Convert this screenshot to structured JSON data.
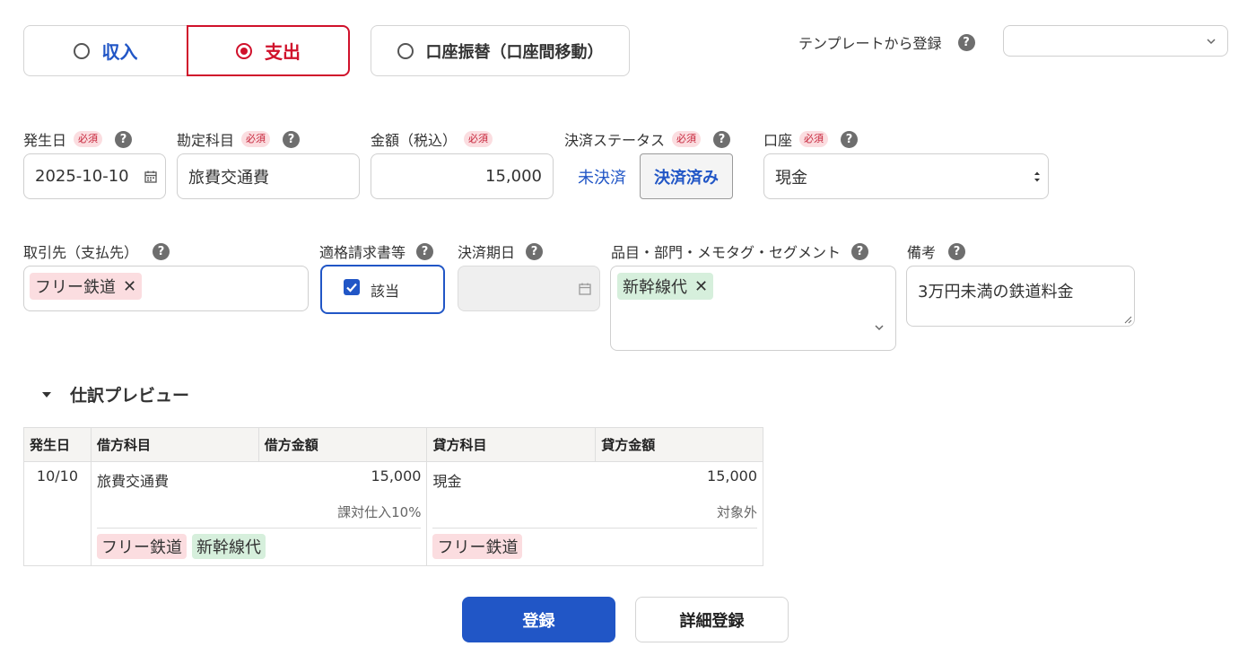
{
  "type_selector": {
    "income_label": "収入",
    "expense_label": "支出",
    "transfer_label": "口座振替（口座間移動）",
    "selected": "expense"
  },
  "template": {
    "label": "テンプレートから登録",
    "value": ""
  },
  "fields": {
    "required_badge": "必須",
    "date": {
      "label": "発生日",
      "value": "2025-10-10"
    },
    "account_item": {
      "label": "勘定科目",
      "value": "旅費交通費"
    },
    "amount": {
      "label": "金額（税込）",
      "value": "15,000"
    },
    "settlement_status": {
      "label": "決済ステータス",
      "unsettled": "未決済",
      "settled": "決済済み",
      "selected": "settled"
    },
    "wallet": {
      "label": "口座",
      "value": "現金"
    },
    "partner": {
      "label": "取引先（支払先）",
      "tag": "フリー鉄道"
    },
    "qualified_invoice": {
      "label": "適格請求書等",
      "checkbox_label": "該当",
      "checked": true
    },
    "settlement_due": {
      "label": "決済期日",
      "value": ""
    },
    "tags": {
      "label": "品目・部門・メモタグ・セグメント",
      "tag": "新幹線代"
    },
    "memo": {
      "label": "備考",
      "value": "3万円未満の鉄道料金"
    }
  },
  "preview": {
    "toggle_label": "仕訳プレビュー",
    "headers": [
      "発生日",
      "借方科目",
      "借方金額",
      "貸方科目",
      "貸方金額"
    ],
    "row": {
      "date": "10/10",
      "debit_account": "旅費交通費",
      "debit_amount": "15,000",
      "debit_tax": "課対仕入10%",
      "credit_account": "現金",
      "credit_amount": "15,000",
      "credit_tax": "対象外",
      "debit_partner_tag": "フリー鉄道",
      "debit_item_tag": "新幹線代",
      "credit_partner_tag": "フリー鉄道"
    }
  },
  "actions": {
    "register": "登録",
    "detail_register": "詳細登録"
  },
  "colors": {
    "primary": "#2156c6",
    "expense_red": "#d0112b",
    "tag_red_bg": "#fbdde0",
    "tag_green_bg": "#d6efdc"
  }
}
